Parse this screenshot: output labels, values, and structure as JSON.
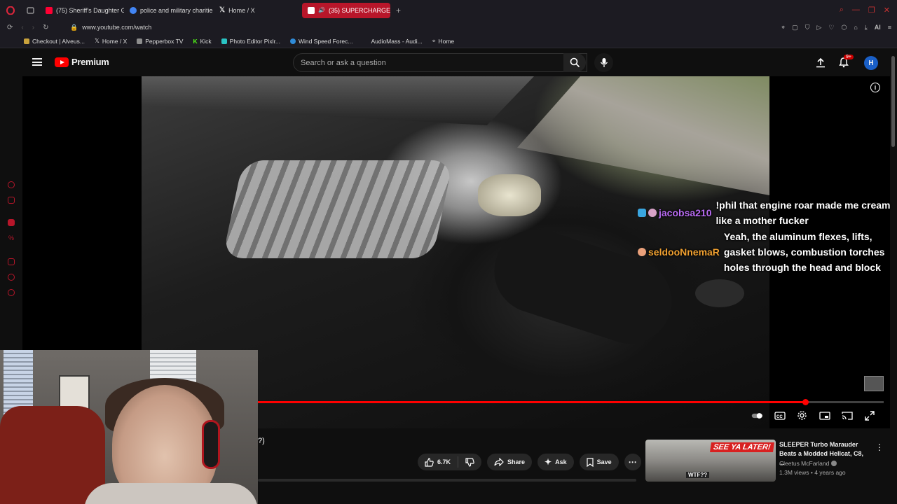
{
  "browser": {
    "tabs": [
      {
        "label": "(75) Sheriff's Daughter Giv",
        "color": "#ff0033"
      },
      {
        "label": "police and military charitie",
        "color": "#4285f4"
      },
      {
        "label": "Home / X",
        "color": "#ffffff"
      },
      {
        "label": "(35) SUPERCHARGED 1",
        "color": "#ff0033",
        "active": true
      }
    ],
    "new_tab_symbol": "+",
    "url": "www.youtube.com/watch",
    "accent_color": "#b8162a",
    "bookmarks": [
      {
        "label": "Checkout | Alveus...",
        "color": "#c9a23c"
      },
      {
        "label": "Home / X",
        "color": "#ffffff"
      },
      {
        "label": "Pepperbox TV",
        "color": "#8e8e8e"
      },
      {
        "label": "Kick",
        "color": "#53fc18"
      },
      {
        "label": "Photo Editor Pixlr...",
        "color": "#2ac3c3"
      },
      {
        "label": "Wind Speed Forec...",
        "color": "#2f8bd8"
      },
      {
        "label": "AudioMass - Audi...",
        "color": "#1c1b22"
      },
      {
        "label": "Home",
        "color": "#dddddd"
      }
    ],
    "ai_label": "AI"
  },
  "youtube": {
    "logo_text": "Premium",
    "search_placeholder": "Search or ask a question",
    "notification_badge": "9+",
    "avatar_letter": "H"
  },
  "chat": [
    {
      "user": "jacobsa210",
      "text": "!phil that engine roar made me cream like a mother fucker",
      "user_color": "#b86bf2"
    },
    {
      "user": "seldooNnemaR",
      "text": "Yeah, the aluminum flexes, lifts, gasket blows, combustion torches holes through the head and block",
      "user_color": "#f0a030"
    }
  ],
  "player": {
    "progress_fraction": 0.875,
    "progress_color": "#ff0000"
  },
  "caption_fragment": "?)",
  "actions": {
    "likes": "6.7K",
    "share": "Share",
    "ask": "Ask",
    "save": "Save"
  },
  "recommended": {
    "thumb_headline": "SEE YA LATER!",
    "thumb_caption": "WTF??",
    "title": "SLEEPER Turbo Marauder Beats a Modded Hellcat, C8, ...",
    "channel": "Cleetus McFarland",
    "meta": "1.3M views • 4 years ago"
  }
}
